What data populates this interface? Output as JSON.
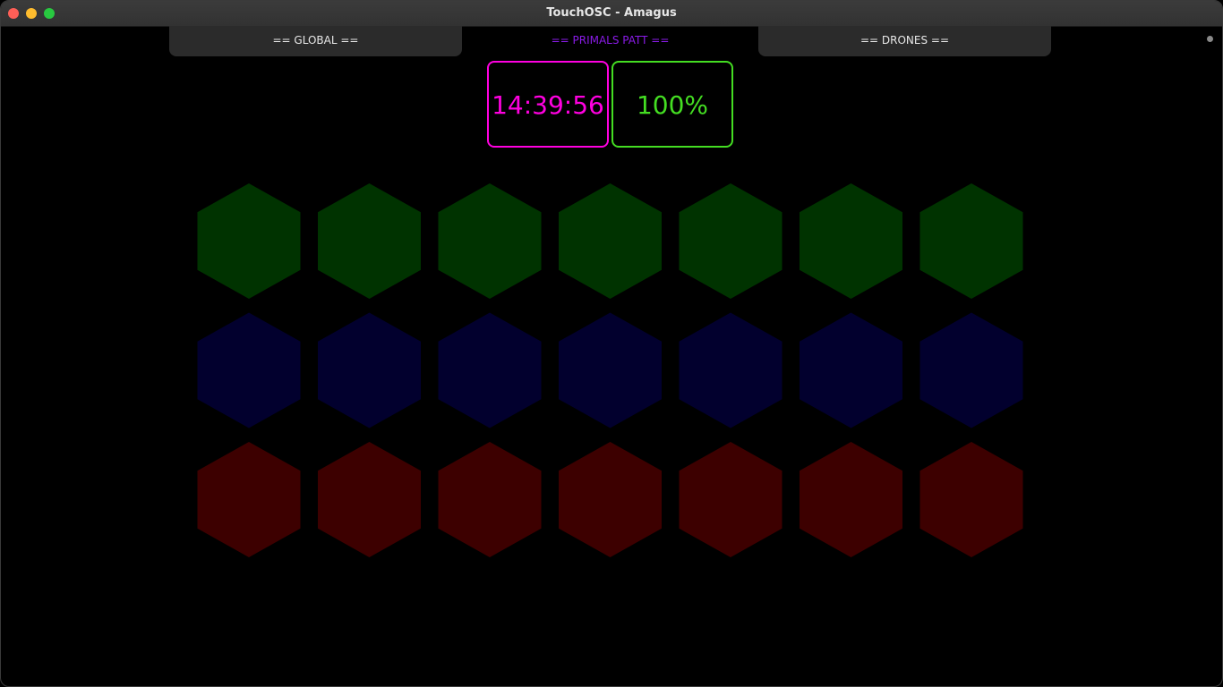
{
  "window": {
    "title": "TouchOSC - Amagus"
  },
  "tabs": [
    {
      "label": "== GLOBAL ==",
      "active": false
    },
    {
      "label": "== PRIMALS PATT ==",
      "active": true
    },
    {
      "label": "== DRONES ==",
      "active": false
    }
  ],
  "displays": {
    "clock": "14:39:56",
    "percent": "100%"
  },
  "colors": {
    "tab_active": "#8a1be8",
    "clock": "#ff00e0",
    "percent": "#44dd22",
    "row_green": "#003300",
    "row_blue": "#02002e",
    "row_red": "#3d0000"
  },
  "pads": {
    "rows": [
      {
        "color_key": "row_green",
        "count": 7
      },
      {
        "color_key": "row_blue",
        "count": 7
      },
      {
        "color_key": "row_red",
        "count": 7
      }
    ]
  }
}
